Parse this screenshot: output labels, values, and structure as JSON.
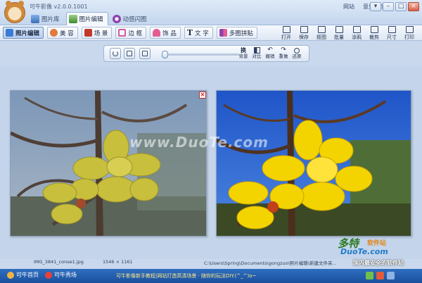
{
  "app": {
    "title": "可牛影像 v2.0.0.1001"
  },
  "tabs": [
    {
      "label": "图片库"
    },
    {
      "label": "图片编辑"
    },
    {
      "label": "动感闪图"
    }
  ],
  "title_links": {
    "website": "网站",
    "feedback": "意见反馈"
  },
  "window_controls": {
    "menu": "▾",
    "minimize": "–",
    "maximize": "□",
    "close": "×"
  },
  "categories": [
    {
      "label": "照片编辑",
      "icon": "photo-edit-icon",
      "color": "#3a7bd5"
    },
    {
      "label": "美 容",
      "icon": "face-icon",
      "color": "#e07b39"
    },
    {
      "label": "场 景",
      "icon": "scene-icon",
      "color": "#c0392b"
    },
    {
      "label": "边 框",
      "icon": "frame-icon",
      "color": "#d35aa0"
    },
    {
      "label": "饰 品",
      "icon": "decoration-icon",
      "color": "#e35d92"
    },
    {
      "label": "文 字",
      "icon": "text-icon",
      "color": "#2c3e50"
    },
    {
      "label": "多图拼贴",
      "icon": "collage-icon",
      "color": "#8e44ad"
    }
  ],
  "actions": [
    {
      "label": "打开",
      "icon": "open-icon"
    },
    {
      "label": "保存",
      "icon": "save-icon"
    },
    {
      "label": "抠图",
      "icon": "cutout-icon"
    },
    {
      "label": "批量",
      "icon": "batch-icon"
    },
    {
      "label": "涂鸦",
      "icon": "doodle-icon"
    },
    {
      "label": "裁剪",
      "icon": "crop-icon"
    },
    {
      "label": "尺寸",
      "icon": "resize-icon"
    },
    {
      "label": "打印",
      "icon": "print-icon"
    }
  ],
  "view_controls": {
    "swap": {
      "top": "换",
      "label": "背景"
    },
    "compare": {
      "label": "对比"
    },
    "undo": {
      "label": "撤销"
    },
    "redo": {
      "label": "重做"
    },
    "restore": {
      "label": "还原"
    },
    "zoom": 0.02
  },
  "watermark": "www.DuoTe.com",
  "close_glyph": "×",
  "photo_info": {
    "filename": "IMG_3841_conse1.jpg",
    "dimensions": "1546 × 1161",
    "path": "C:\\Users\\Spring\\Documents\\gongzuo\\照片编辑\\新建文件夹..."
  },
  "statusbar": {
    "home": "可牛首页",
    "show": "可牛秀场",
    "ticker": "可牛影像新手教程|网站打造高清场景 · 随你的玩法DIY.(^_^)o~",
    "colors": {
      "bar": "#1b4f9c",
      "ticker": "#ffe98a"
    }
  },
  "site_watermark": {
    "logo": "多特",
    "sub": "软件站",
    "url": "DuoTe.com",
    "tag": "国内最安全的软件站"
  }
}
